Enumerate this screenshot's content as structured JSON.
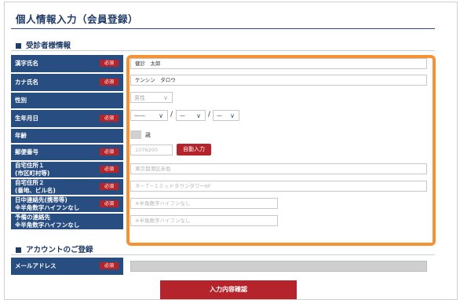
{
  "page_title": "個人情報入力（会員登録）",
  "section_patient": "受診者様情報",
  "section_account": "アカウントのご登録",
  "required_badge": "必須",
  "labels": {
    "kanji_name": "漢字氏名",
    "kana_name": "カナ氏名",
    "gender": "性別",
    "birthdate": "生年月日",
    "age": "年齢",
    "postal_code": "郵便番号",
    "address1_line1": "自宅住所１",
    "address1_line2": "(市区町村等)",
    "address2_line1": "自宅住所２",
    "address2_line2": "(番地、ビル名)",
    "day_phone_line1": "日中連絡先(携帯等)",
    "day_phone_line2": "※半角数字ハイフンなし",
    "alt_phone_line1": "予備の連絡先",
    "alt_phone_line2": "※半角数字ハイフンなし",
    "email": "メールアドレス"
  },
  "values": {
    "kanji_name": "健診　太郎",
    "kana_name": "ケンシン　タロウ",
    "gender": "男性",
    "birth_year": "——",
    "birth_month": "—",
    "birth_day": "—",
    "age_unit": "歳"
  },
  "placeholders": {
    "postal_code": "1076200",
    "address1": "東京都港区赤坂",
    "address2": "９−７−１ミッドタウンタワー6F",
    "day_phone": "※半角数字ハイフンなし",
    "alt_phone": "※半角数字ハイフンなし"
  },
  "buttons": {
    "auto_fill": "自動入力",
    "confirm": "入力内容確認"
  },
  "colors": {
    "label_bg": "#284d80",
    "required": "#b5242a",
    "highlight": "#f59234"
  }
}
